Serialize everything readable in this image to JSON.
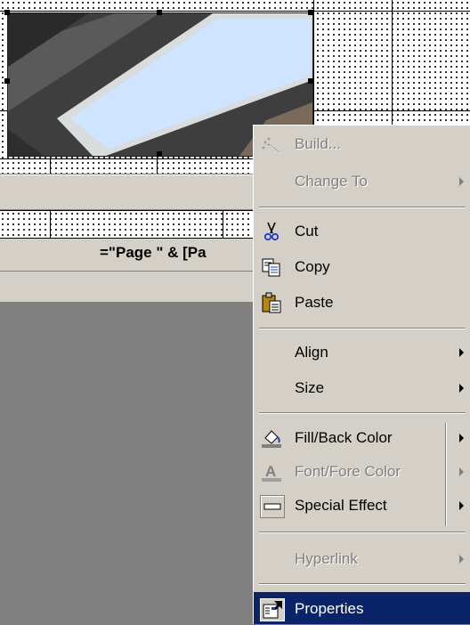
{
  "report": {
    "footer_expression": "=\"Page \" & [Pa"
  },
  "context_menu": {
    "items": [
      {
        "label": "Build...",
        "icon": "build-icon",
        "disabled": true,
        "submenu": false
      },
      {
        "label": "Change To",
        "icon": "",
        "disabled": true,
        "submenu": true
      },
      {
        "label": "Cut",
        "icon": "scissors-icon",
        "disabled": false,
        "submenu": false
      },
      {
        "label": "Copy",
        "icon": "copy-icon",
        "disabled": false,
        "submenu": false
      },
      {
        "label": "Paste",
        "icon": "paste-icon",
        "disabled": false,
        "submenu": false
      },
      {
        "label": "Align",
        "icon": "",
        "disabled": false,
        "submenu": true
      },
      {
        "label": "Size",
        "icon": "",
        "disabled": false,
        "submenu": true
      },
      {
        "label": "Fill/Back Color",
        "icon": "fill-color-icon",
        "disabled": false,
        "submenu": true
      },
      {
        "label": "Font/Fore Color",
        "icon": "font-color-icon",
        "disabled": true,
        "submenu": true
      },
      {
        "label": "Special Effect",
        "icon": "special-effect-icon",
        "disabled": false,
        "submenu": true
      },
      {
        "label": "Hyperlink",
        "icon": "",
        "disabled": true,
        "submenu": true
      },
      {
        "label": "Properties",
        "icon": "properties-icon",
        "disabled": false,
        "submenu": false,
        "highlighted": true
      }
    ]
  },
  "colors": {
    "menu_bg": "#d4d0c8",
    "highlight": "#0a246a",
    "disabled_text": "#808080",
    "picture_fill": "#cfe4ff"
  }
}
